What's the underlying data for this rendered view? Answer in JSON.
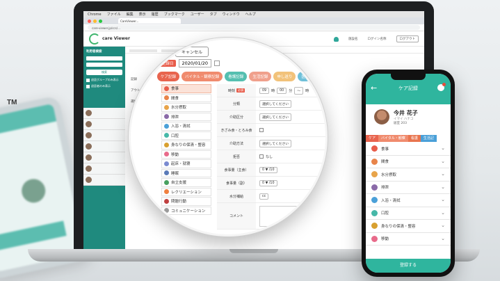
{
  "trademark": "TM",
  "browser": {
    "menubar": [
      "Chrome",
      "ファイル",
      "編集",
      "表示",
      "履歴",
      "ブックマーク",
      "ユーザー",
      "タブ",
      "ウィンドウ",
      "ヘルプ"
    ],
    "tab_title": "CareViewer...",
    "url": "care-viewer.jp/ccs/..."
  },
  "app": {
    "logo_text": "care Viewer",
    "header_links": [
      "施設名",
      "ログイン名称"
    ],
    "logout": "ログアウト",
    "sidebar": {
      "title": "利用者検索",
      "search_button": "検索",
      "checks": [
        "退居グループのみ表示",
        "退居者のみ表示"
      ]
    },
    "sublist": [
      "記録",
      "アウトライ",
      "選択",
      "ケア",
      "選択",
      "記録"
    ]
  },
  "magnifier": {
    "cancel": "キャンセル",
    "date_label": "記録日",
    "date_value": "2020/01/20",
    "tabs": [
      {
        "label": "ケア記録",
        "color": "#e8644e"
      },
      {
        "label": "バイタル・観察記録",
        "color": "#f08b6e"
      },
      {
        "label": "看護記録",
        "color": "#55bfb0"
      },
      {
        "label": "生活記録",
        "color": "#f0a08c"
      },
      {
        "label": "申し送り",
        "color": "#f2c27a"
      },
      {
        "label": "医療",
        "color": "#6fc0d9"
      }
    ],
    "categories": [
      {
        "label": "食事",
        "color": "#e85c4a"
      },
      {
        "label": "間食",
        "color": "#e8844a"
      },
      {
        "label": "水分摂取",
        "color": "#e8a44a"
      },
      {
        "label": "排泄",
        "color": "#8a6aa8"
      },
      {
        "label": "入浴・清拭",
        "color": "#4aa0d8"
      },
      {
        "label": "口腔",
        "color": "#46b8a8"
      },
      {
        "label": "身なりの保清・整容",
        "color": "#d8a030"
      },
      {
        "label": "移動",
        "color": "#e86a8a"
      },
      {
        "label": "起床・就寝",
        "color": "#7a8ad0"
      },
      {
        "label": "睡眠",
        "color": "#5a7ab8"
      },
      {
        "label": "自立支援",
        "color": "#48a060"
      },
      {
        "label": "レクリエーション",
        "color": "#f08040"
      },
      {
        "label": "問題行動",
        "color": "#c04040"
      },
      {
        "label": "コミュニケーション",
        "color": "#9a9a9a"
      }
    ],
    "form": {
      "time_label": "時刻",
      "required": "必須",
      "time_values": [
        "09",
        "時",
        "00",
        "分",
        "～",
        "時"
      ],
      "rows": [
        {
          "label": "分類",
          "value": "選択してください"
        },
        {
          "label": "介助区分",
          "value": "選択してください"
        },
        {
          "label": "きざみ食・とろみ食",
          "value": ""
        },
        {
          "label": "介助方法",
          "value": "選択してください"
        },
        {
          "label": "拒否",
          "value": "なし"
        },
        {
          "label": "食事量（主食）",
          "value": "0 ▼ /10"
        },
        {
          "label": "食事量（副）",
          "value": "0 ▼ /10"
        },
        {
          "label": "水分補給",
          "value": "cc"
        },
        {
          "label": "コメント",
          "value": ""
        }
      ]
    }
  },
  "phone": {
    "title": "ケア記録",
    "name": "今井 花子",
    "kana": "イマイ ハナコ",
    "room": "居室 203",
    "tabs": [
      {
        "label": "ケア",
        "color": "#e8644e"
      },
      {
        "label": "バイタル・観察",
        "color": "#f08b6e"
      },
      {
        "label": "看護",
        "color": "#e8744e"
      },
      {
        "label": "生活記",
        "color": "#4aa0d8"
      }
    ],
    "items": [
      {
        "label": "食事",
        "color": "#e85c4a"
      },
      {
        "label": "間食",
        "color": "#e8844a"
      },
      {
        "label": "水分摂取",
        "color": "#e8a44a"
      },
      {
        "label": "排泄",
        "color": "#8a6aa8"
      },
      {
        "label": "入浴・清拭",
        "color": "#4aa0d8"
      },
      {
        "label": "口腔",
        "color": "#46b8a8"
      },
      {
        "label": "身なりの保清・整容",
        "color": "#d8a030"
      },
      {
        "label": "移動",
        "color": "#e86a8a"
      }
    ],
    "submit": "登録する"
  }
}
